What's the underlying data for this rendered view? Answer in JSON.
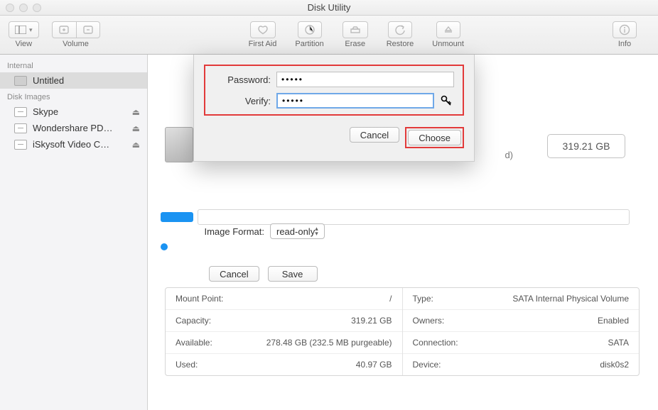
{
  "window": {
    "title": "Disk Utility"
  },
  "toolbar": {
    "view": "View",
    "volume": "Volume",
    "first_aid": "First Aid",
    "partition": "Partition",
    "erase": "Erase",
    "restore": "Restore",
    "unmount": "Unmount",
    "info": "Info"
  },
  "sidebar": {
    "sections": [
      {
        "title": "Internal",
        "items": [
          {
            "label": "Untitled",
            "kind": "disk",
            "eject": false
          }
        ]
      },
      {
        "title": "Disk Images",
        "items": [
          {
            "label": "Skype",
            "kind": "image",
            "eject": true
          },
          {
            "label": "Wondershare PD…",
            "kind": "image",
            "eject": true
          },
          {
            "label": "iSkysoft Video C…",
            "kind": "image",
            "eject": true
          }
        ]
      }
    ]
  },
  "dialog": {
    "password_label": "Password:",
    "verify_label": "Verify:",
    "password_value": "•••••",
    "verify_value": "•••••",
    "cancel": "Cancel",
    "choose": "Choose"
  },
  "sheet": {
    "encryption_suffix": "d)",
    "image_format_label": "Image Format:",
    "image_format_value": "read-only",
    "cancel": "Cancel",
    "save": "Save"
  },
  "disk": {
    "size": "319.21 GB"
  },
  "info": {
    "left": [
      {
        "label": "Mount Point:",
        "value": "/"
      },
      {
        "label": "Capacity:",
        "value": "319.21 GB"
      },
      {
        "label": "Available:",
        "value": "278.48 GB (232.5 MB purgeable)"
      },
      {
        "label": "Used:",
        "value": "40.97 GB"
      }
    ],
    "right": [
      {
        "label": "Type:",
        "value": "SATA Internal Physical Volume"
      },
      {
        "label": "Owners:",
        "value": "Enabled"
      },
      {
        "label": "Connection:",
        "value": "SATA"
      },
      {
        "label": "Device:",
        "value": "disk0s2"
      }
    ]
  }
}
